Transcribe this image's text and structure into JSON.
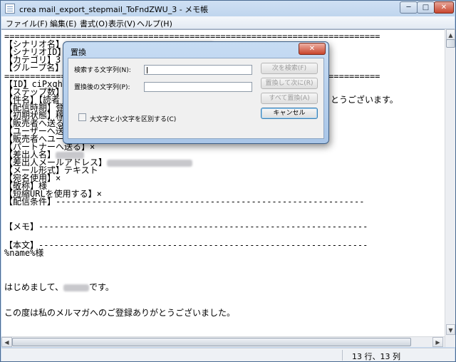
{
  "window": {
    "title": "crea mail_export_stepmail_ToFndZWU_3 - メモ帳",
    "min_glyph": "─",
    "max_glyph": "□",
    "close_glyph": "✕"
  },
  "menu": [
    "ファイル(F)",
    "編集(E)",
    "書式(O)",
    "表示(V)",
    "ヘルプ(H)"
  ],
  "editor": {
    "lines": [
      "=========================================================================",
      "【シナリオ名】",
      "【シナリオID】",
      "【カテゴリ】3",
      "【グループ名】",
      "=========================================================================",
      "【ID】ciPxqhWu",
      "【ステップ数】",
      "【件名】【読者",
      "【配信時期】登",
      "【初期状態】稼",
      "【販売者へ送る",
      "【ユーザーへ送",
      "【販売者へユーザーアドレスから送る】",
      "【パートナーへ送る】×",
      "【差出人名】",
      "【差出人メールアドレス】",
      "【メール形式】テキスト",
      "【宛名使用】×",
      "【敬称】様",
      "【短縮URLを使用する】×",
      "【配信条件】------------------------------------------------------------",
      "",
      "【メモ】----------------------------------------------------------------",
      "",
      "【本文】----------------------------------------------------------------",
      "%name%様",
      "",
      "",
      "はじめまして、です。",
      "",
      "この度は私のメルマガへのご登録ありがとうございました。"
    ],
    "partial_line_tail": "とうございます。"
  },
  "status": {
    "position": "13 行、13 列"
  },
  "dialog": {
    "title": "置換",
    "close_glyph": "✕",
    "find_label": "検索する文字列(N):",
    "find_value": "",
    "replace_label": "置換後の文字列(P):",
    "replace_value": "",
    "match_case_label": "大文字と小文字を区別する(C)",
    "match_case_checked": false,
    "buttons": {
      "find_next": "次を検索(F)",
      "replace": "置換して次に(R)",
      "replace_all": "すべて置換(A)",
      "cancel": "キャンセル"
    }
  }
}
